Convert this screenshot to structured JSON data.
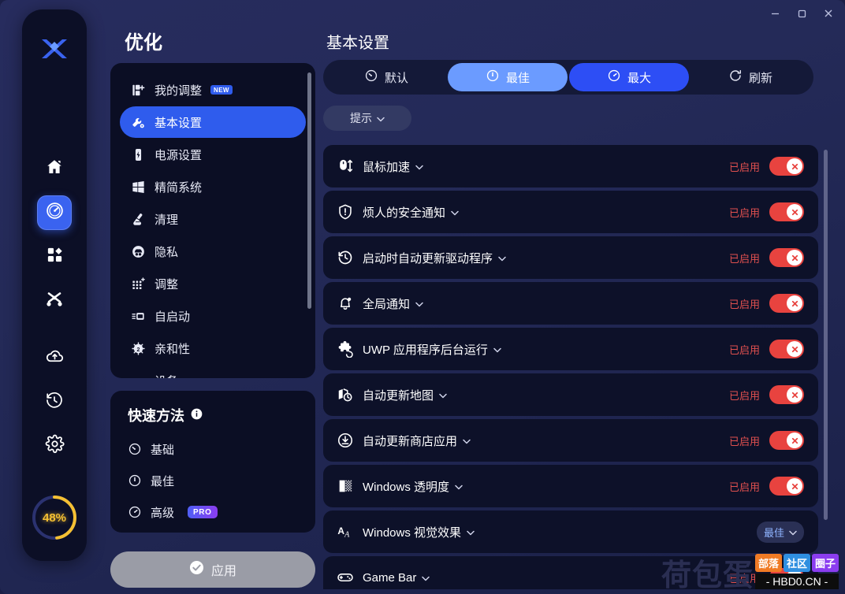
{
  "window": {
    "minimize_label": "minimize",
    "maximize_label": "maximize",
    "close_label": "close"
  },
  "rail": {
    "logo": "x-logo",
    "items": [
      {
        "name": "home",
        "icon": "home-icon",
        "active": false
      },
      {
        "name": "optimize",
        "icon": "gauge-icon",
        "active": true
      },
      {
        "name": "apps",
        "icon": "grid-icon",
        "active": false
      },
      {
        "name": "network",
        "icon": "network-icon",
        "active": false
      },
      {
        "name": "cloud",
        "icon": "cloud-upload-icon",
        "active": false
      },
      {
        "name": "history",
        "icon": "history-icon",
        "active": false
      },
      {
        "name": "settings",
        "icon": "gear-icon",
        "active": false
      }
    ],
    "progress_percent": "48%"
  },
  "optimize": {
    "title": "优化",
    "nav_items": [
      {
        "label": "我的调整",
        "icon": "my-tweaks-icon",
        "badge": "NEW",
        "active": false
      },
      {
        "label": "基本设置",
        "icon": "wrench-icon",
        "badge": "",
        "active": true
      },
      {
        "label": "电源设置",
        "icon": "battery-icon",
        "badge": "",
        "active": false
      },
      {
        "label": "精简系统",
        "icon": "windows-icon",
        "badge": "",
        "active": false
      },
      {
        "label": "清理",
        "icon": "broom-icon",
        "badge": "",
        "active": false
      },
      {
        "label": "隐私",
        "icon": "privacy-icon",
        "badge": "",
        "active": false
      },
      {
        "label": "调整",
        "icon": "tune-icon",
        "badge": "",
        "active": false
      },
      {
        "label": "自启动",
        "icon": "startup-icon",
        "badge": "",
        "active": false
      },
      {
        "label": "亲和性",
        "icon": "cpu-icon",
        "badge": "",
        "active": false
      },
      {
        "label": "设备",
        "icon": "device-icon",
        "badge": "",
        "active": false
      }
    ],
    "quick": {
      "title": "快速方法",
      "info_icon": "info-icon",
      "items": [
        {
          "label": "基础",
          "icon": "gauge-low-icon",
          "badge": ""
        },
        {
          "label": "最佳",
          "icon": "gauge-mid-icon",
          "badge": ""
        },
        {
          "label": "高级",
          "icon": "gauge-high-icon",
          "badge": "PRO"
        }
      ]
    },
    "apply_label": "应用",
    "apply_icon": "check-circle-icon"
  },
  "main": {
    "title": "基本设置",
    "segments": [
      {
        "label": "默认",
        "icon": "gauge-low-icon",
        "style": "plain"
      },
      {
        "label": "最佳",
        "icon": "gauge-mid-icon",
        "style": "light"
      },
      {
        "label": "最大",
        "icon": "gauge-high-icon",
        "style": "strong"
      },
      {
        "label": "刷新",
        "icon": "refresh-icon",
        "style": "plain"
      }
    ],
    "hint_label": "提示",
    "enabled_text": "已启用",
    "rows": [
      {
        "label": "鼠标加速",
        "icon": "mouse-icon",
        "control": "toggle",
        "state": "已启用"
      },
      {
        "label": "烦人的安全通知",
        "icon": "shield-alert-icon",
        "control": "toggle",
        "state": "已启用"
      },
      {
        "label": "启动时自动更新驱动程序",
        "icon": "clock-refresh-icon",
        "control": "toggle",
        "state": "已启用"
      },
      {
        "label": "全局通知",
        "icon": "bell-icon",
        "control": "toggle",
        "state": "已启用"
      },
      {
        "label": "UWP 应用程序后台运行",
        "icon": "puzzle-icon",
        "control": "toggle",
        "state": "已启用"
      },
      {
        "label": "自动更新地图",
        "icon": "map-clock-icon",
        "control": "toggle",
        "state": "已启用"
      },
      {
        "label": "自动更新商店应用",
        "icon": "download-circle-icon",
        "control": "toggle",
        "state": "已启用"
      },
      {
        "label": "Windows 透明度",
        "icon": "transparency-icon",
        "control": "toggle",
        "state": "已启用"
      },
      {
        "label": "Windows 视觉效果",
        "icon": "font-aa-icon",
        "control": "select",
        "state": "最佳"
      },
      {
        "label": "Game Bar",
        "icon": "gamepad-icon",
        "control": "toggle",
        "state": "已启用"
      }
    ]
  },
  "watermark": {
    "brand": "荷包蛋",
    "tags": [
      {
        "text": "部落",
        "color": "#f07b25"
      },
      {
        "text": "社区",
        "color": "#2f8fe0"
      },
      {
        "text": "圈子",
        "color": "#8b3df0"
      }
    ],
    "url": "- HBD0.CN -"
  }
}
